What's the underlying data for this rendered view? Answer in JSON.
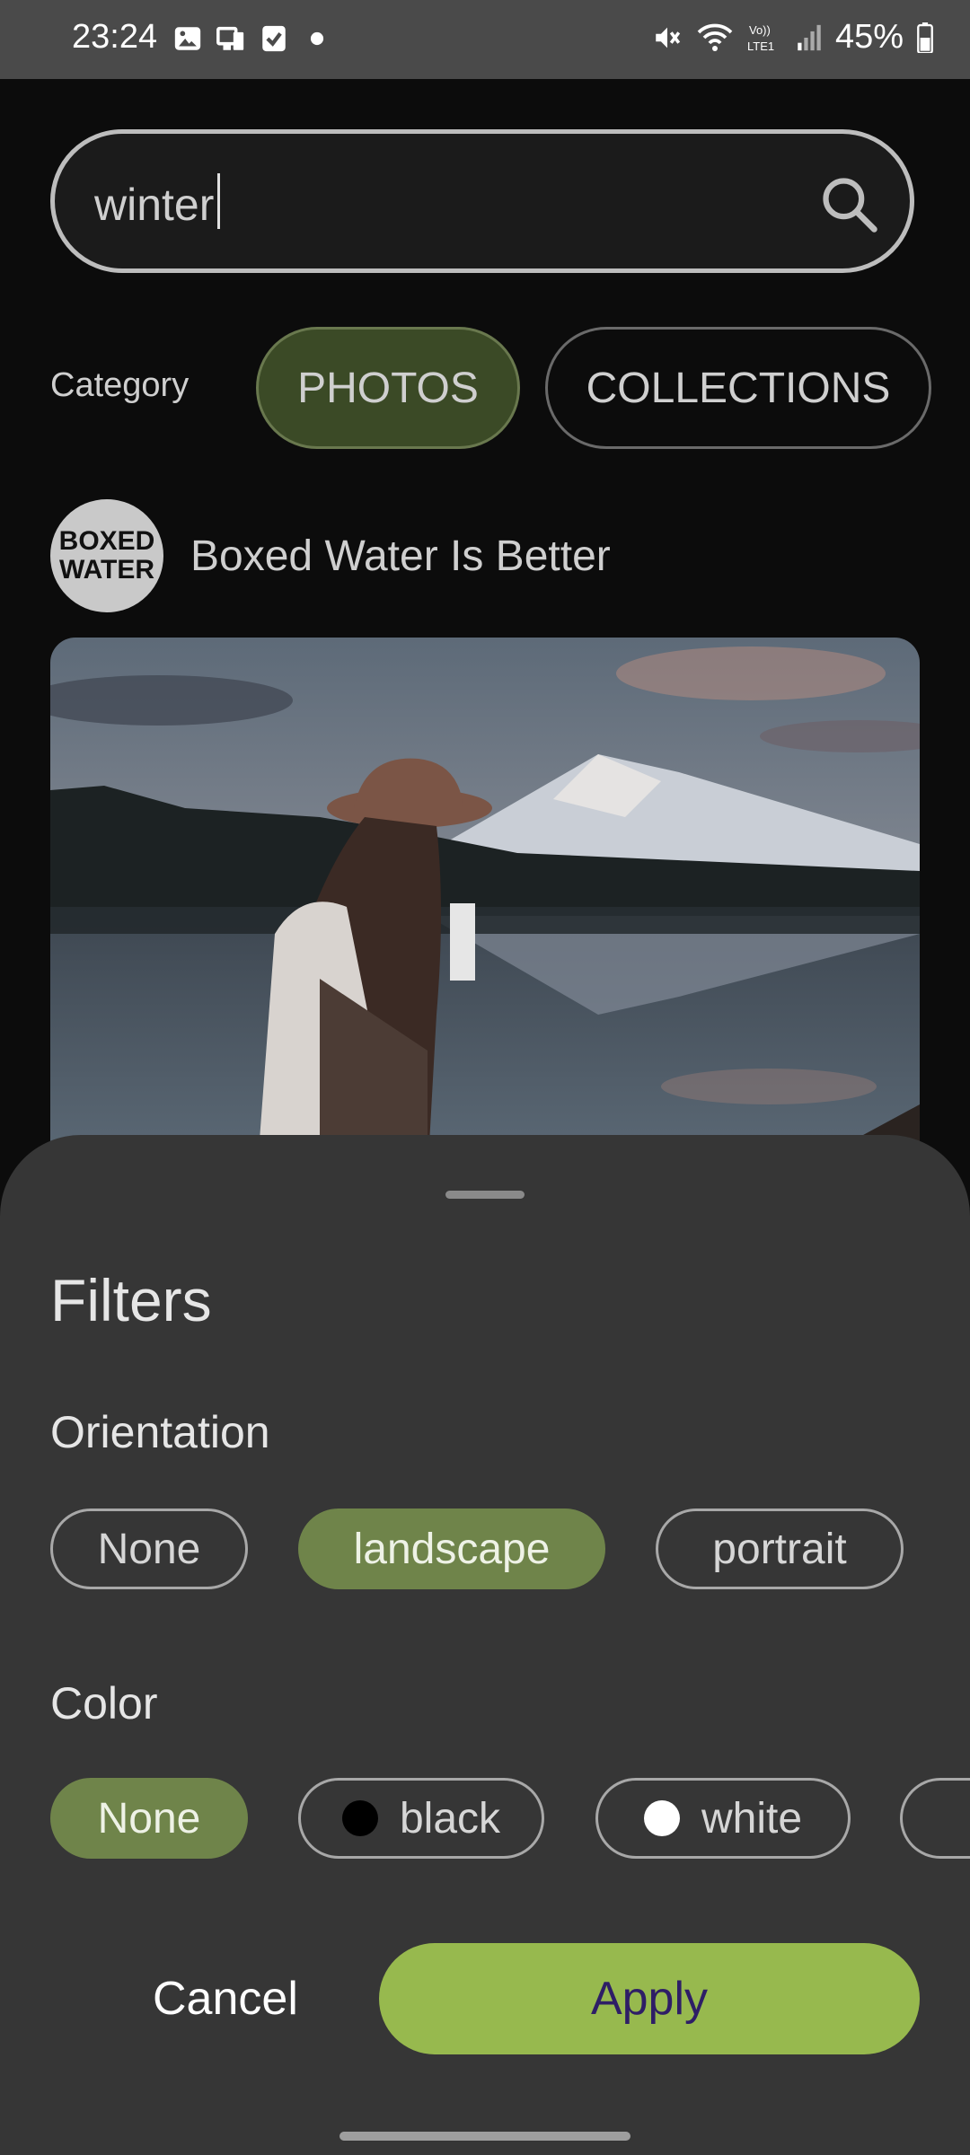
{
  "status_bar": {
    "time": "23:24",
    "battery": "45%"
  },
  "search": {
    "query": "winter"
  },
  "category": {
    "label": "Category",
    "options": [
      "PHOTOS",
      "COLLECTIONS"
    ],
    "selected": "PHOTOS"
  },
  "result": {
    "avatar_text": "BOXED WATER",
    "user_name": "Boxed Water Is Better"
  },
  "filters": {
    "title": "Filters",
    "orientation": {
      "title": "Orientation",
      "options": [
        "None",
        "landscape",
        "portrait"
      ],
      "selected": "landscape"
    },
    "color": {
      "title": "Color",
      "options": [
        {
          "label": "None",
          "swatch": ""
        },
        {
          "label": "black",
          "swatch": "#000000"
        },
        {
          "label": "white",
          "swatch": "#ffffff"
        }
      ],
      "selected": "None"
    },
    "cancel_label": "Cancel",
    "apply_label": "Apply"
  },
  "colors": {
    "accent": "#97b94e",
    "chip_selected": "#6f844a",
    "sheet_bg": "#363636"
  }
}
